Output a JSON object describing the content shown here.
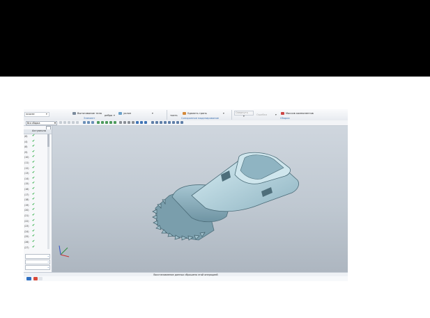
{
  "ribbon": {
    "combo_left": "эскизе",
    "combo_body": "гр",
    "extrude_label": "Вытягивание тела",
    "edge_label": "ребра",
    "draft_label": "уклон",
    "group_features": "Элемент",
    "face_label": "ткать",
    "delete_face": "Удалить грань",
    "group_sync": "Синхронное моделирование",
    "combo_grayed": "Свернуть",
    "item_grayed": "Ошибка",
    "component_label": "Массив компонентов",
    "group_assembly": "Сборка"
  },
  "toolbar": {
    "filter_select": "Вся сборка"
  },
  "navigator": {
    "header_col": "Актуально",
    "rows": [
      {
        "label": "(6)"
      },
      {
        "label": "(4)"
      },
      {
        "label": "(8)"
      },
      {
        "label": "(9)"
      },
      {
        "label": "(10)"
      },
      {
        "label": "(11)"
      },
      {
        "label": "(12)"
      },
      {
        "label": "(13)"
      },
      {
        "label": "(14)"
      },
      {
        "label": "(15)"
      },
      {
        "label": "(16)"
      },
      {
        "label": "(17)"
      },
      {
        "label": "(18)"
      },
      {
        "label": "(19)"
      },
      {
        "label": "(20)"
      },
      {
        "label": "(21)"
      },
      {
        "label": "(22)"
      },
      {
        "label": "(23)"
      },
      {
        "label": "(24)"
      },
      {
        "label": "(25)"
      },
      {
        "label": "(26)"
      },
      {
        "label": "(27)"
      }
    ]
  },
  "status": {
    "message": "Восстановление данных сброшено этой операцией"
  },
  "colors": {
    "part_fill": "#b9d6df",
    "check": "#1fa838",
    "accent": "#3a6fb0"
  }
}
